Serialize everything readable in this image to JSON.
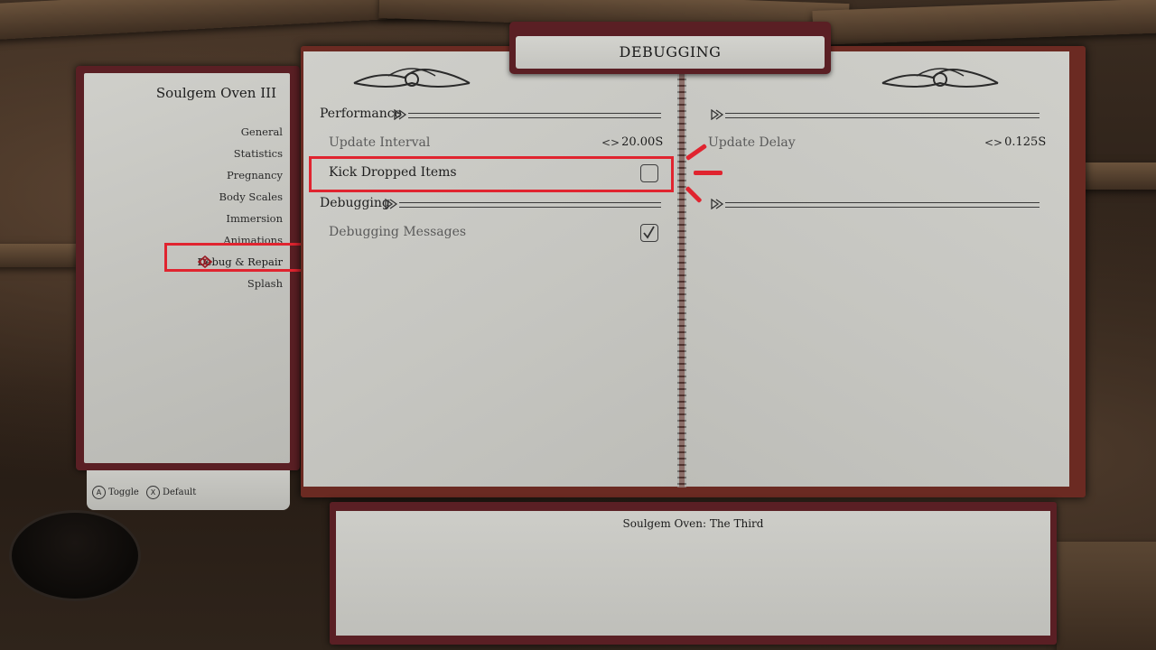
{
  "menu": {
    "title": "Soulgem Oven III",
    "items": [
      {
        "label": "General"
      },
      {
        "label": "Statistics"
      },
      {
        "label": "Pregnancy"
      },
      {
        "label": "Body Scales"
      },
      {
        "label": "Immersion"
      },
      {
        "label": "Animations"
      },
      {
        "label": "Debug & Repair",
        "selected": true
      },
      {
        "label": "Splash"
      }
    ]
  },
  "hints": {
    "toggle": {
      "button": "A",
      "label": "Toggle"
    },
    "default": {
      "button": "X",
      "label": "Default"
    }
  },
  "page": {
    "title": "DEBUGGING",
    "left": {
      "performance_header": "Performance",
      "update_interval": {
        "label": "Update Interval",
        "value": "20.00S"
      },
      "kick_dropped_items": {
        "label": "Kick Dropped Items",
        "checked": false
      },
      "debugging_header": "Debugging",
      "debugging_messages": {
        "label": "Debugging Messages",
        "checked": true
      }
    },
    "right": {
      "update_delay": {
        "label": "Update Delay",
        "value": "0.125S"
      }
    }
  },
  "info": {
    "text": "Soulgem Oven: The Third"
  },
  "colors": {
    "highlight": "#e0242f",
    "frame": "#5a1f24",
    "paper": "#c8c8c3"
  }
}
